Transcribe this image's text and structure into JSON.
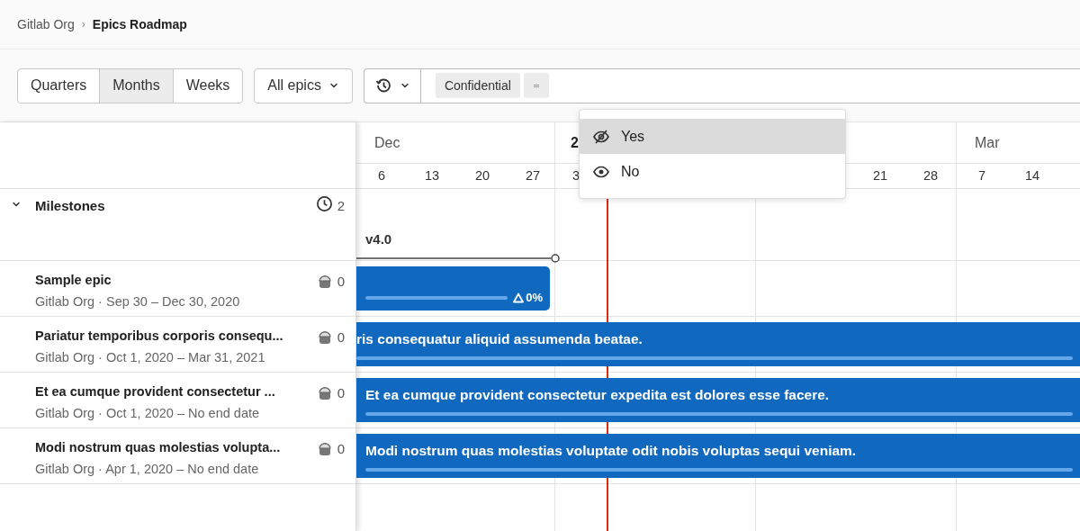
{
  "breadcrumb": [
    "Gitlab Org",
    "Epics Roadmap"
  ],
  "breadcrumb_separator": "›",
  "view_tabs": [
    {
      "label": "Quarters",
      "selected": false
    },
    {
      "label": "Months",
      "selected": true
    },
    {
      "label": "Weeks",
      "selected": false
    }
  ],
  "epics_filter": {
    "label": "All epics"
  },
  "filter_tokens": [
    {
      "kind": "text",
      "label": "Confidential"
    },
    {
      "kind": "icon"
    }
  ],
  "dropdown": {
    "items": [
      {
        "label": "Yes",
        "kind": "hidden",
        "selected": true
      },
      {
        "label": "No",
        "kind": "visible",
        "selected": false
      }
    ]
  },
  "months": [
    {
      "label": "Dec",
      "days": [
        "6",
        "13",
        "20",
        "27"
      ]
    },
    {
      "label": "2",
      "days": [
        "3"
      ]
    },
    {
      "days": [
        "21",
        "28"
      ]
    },
    {
      "label": "Mar",
      "days": [
        "7",
        "14"
      ]
    }
  ],
  "milestones": {
    "label": "Milestones",
    "count": "2",
    "expanded": true,
    "items": [
      {
        "label": "v4.0"
      }
    ]
  },
  "epics": [
    {
      "title": "Sample epic",
      "subtitle": "Gitlab Org · Sep 30 – Dec 30, 2020",
      "count": "0",
      "bar": {
        "ends_in_view": true,
        "progress": "0%"
      }
    },
    {
      "title": "Pariatur temporibus corporis consequ...",
      "subtitle": "Gitlab Org · Oct 1, 2020 – Mar 31, 2021",
      "count": "0",
      "bar": {
        "ends_in_view": false,
        "text": "ris consequatur aliquid assumenda beatae.",
        "text_cut": true
      }
    },
    {
      "title": "Et ea cumque provident consectetur ...",
      "subtitle": "Gitlab Org · Oct 1, 2020 – No end date",
      "count": "0",
      "bar": {
        "ends_in_view": false,
        "text": "Et ea cumque provident consectetur expedita est dolores esse facere.",
        "text_cut": false
      }
    },
    {
      "title": "Modi nostrum quas molestias volupta...",
      "subtitle": "Gitlab Org · Apr 1, 2020 – No end date",
      "count": "0",
      "bar": {
        "ends_in_view": false,
        "text": "Modi nostrum quas molestias voluptate odit nobis voluptas sequi veniam.",
        "text_cut": false
      }
    }
  ]
}
